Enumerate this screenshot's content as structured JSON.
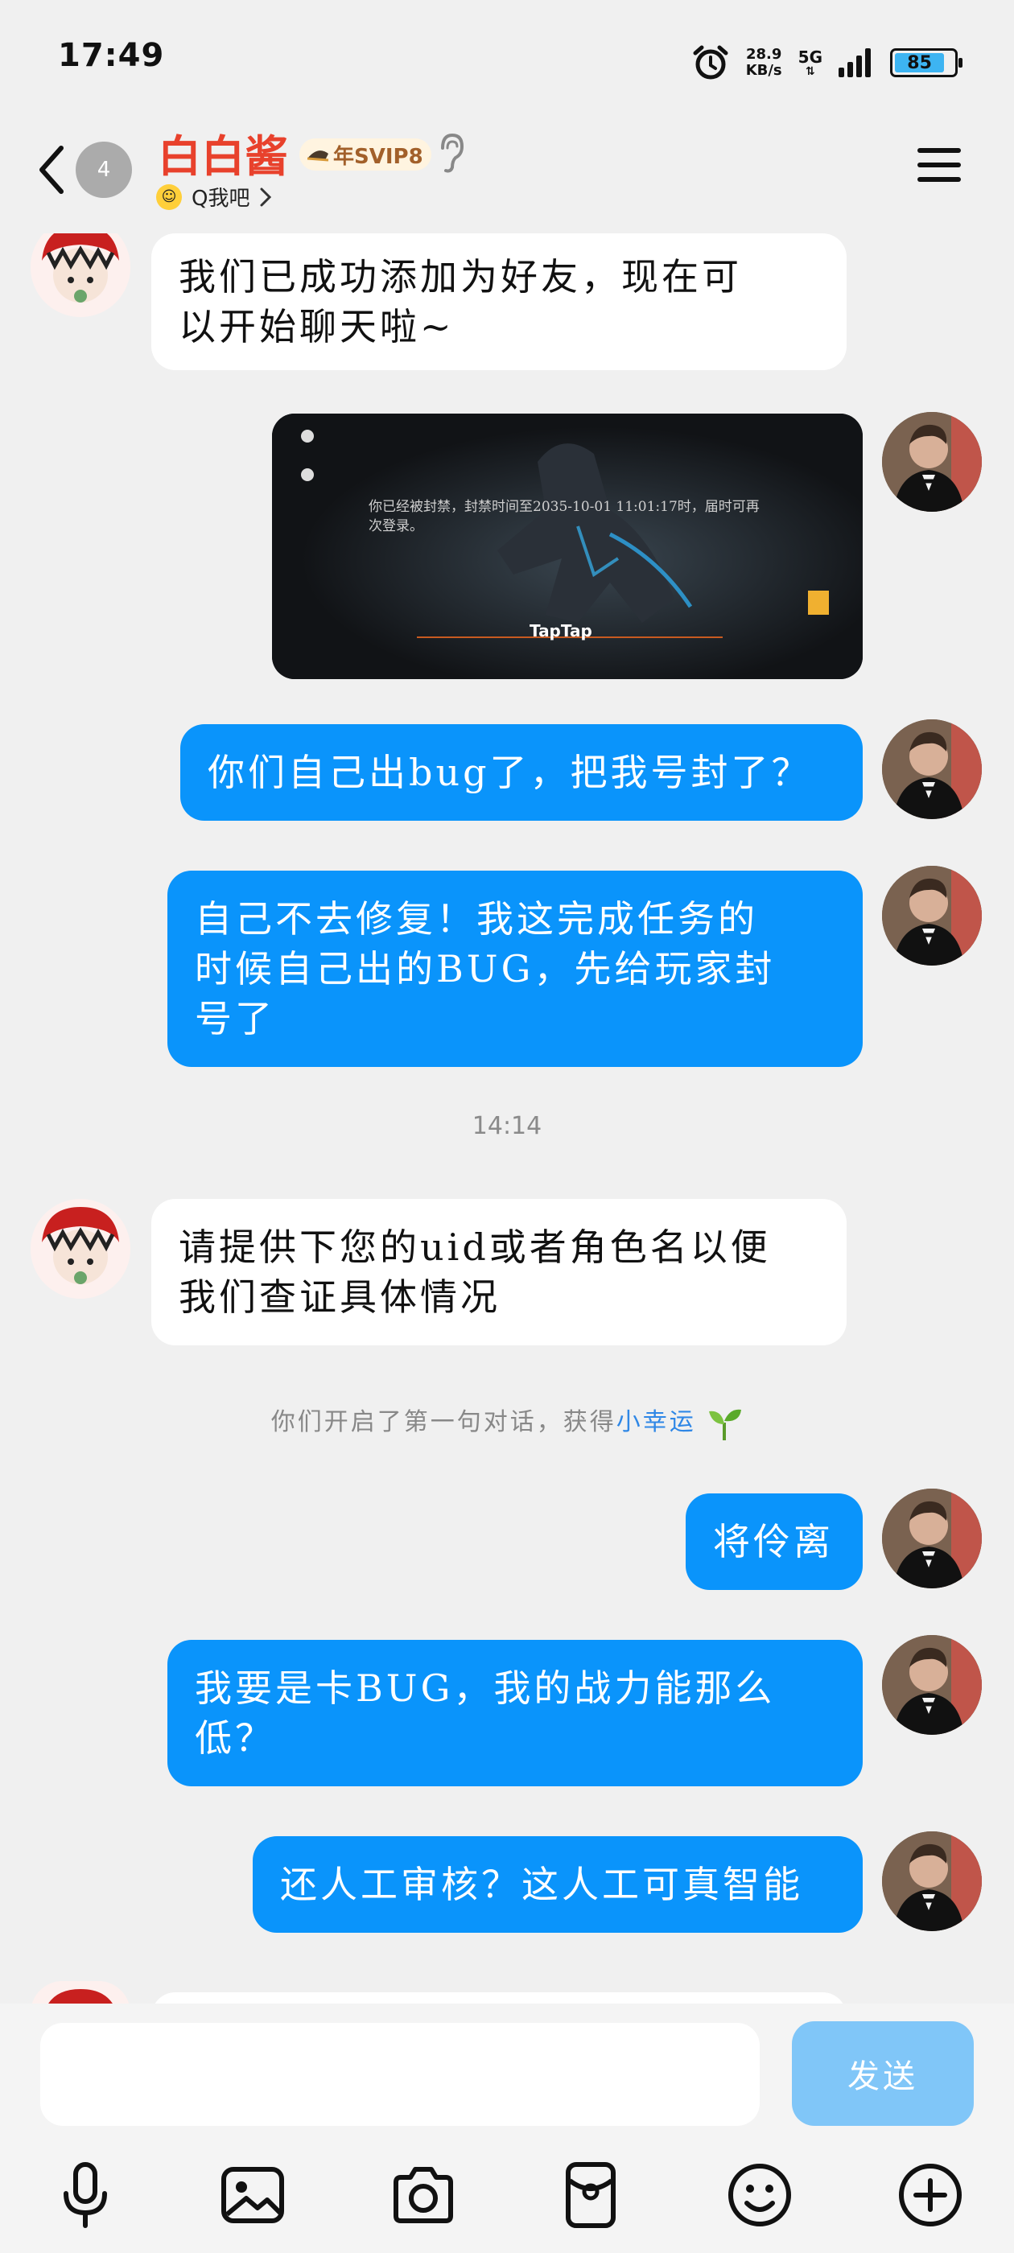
{
  "status_bar": {
    "time": "17:49",
    "speed_value": "28.9",
    "speed_unit": "KB/s",
    "network": "5G",
    "battery": "85",
    "battery_level_percent": 85,
    "icons": [
      "alarm-icon",
      "signal-icon",
      "battery-icon"
    ]
  },
  "header": {
    "unread_count": "4",
    "contact_name": "白白酱",
    "vip_badge": "年SVIP8",
    "status_text": "Q我吧",
    "icons": [
      "back-icon",
      "ear-icon",
      "menu-icon",
      "smile-icon",
      "chevron-right-icon"
    ]
  },
  "messages": [
    {
      "side": "in",
      "text_lines": [
        "我们已成功添加为好友，现在可",
        "以开始聊天啦~"
      ]
    },
    {
      "side": "out",
      "type": "image",
      "image_text": "你已经被封禁，封禁时间至2035-10-01 11:01:17时，届时可再次登录。",
      "image_logo": "TapTap"
    },
    {
      "side": "out",
      "text_lines": [
        "你们自己出bug了，把我号封了？"
      ]
    },
    {
      "side": "out",
      "text_lines": [
        "自己不去修复！我这完成任务的",
        "时候自己出的BUG，先给玩家封",
        "号了"
      ]
    },
    {
      "type": "timestamp",
      "text": "14:14"
    },
    {
      "side": "in",
      "text_lines": [
        "请提供下您的uid或者角色名以便",
        "我们查证具体情况"
      ]
    },
    {
      "type": "notice",
      "text": "你们开启了第一句对话，获得",
      "highlight": "小幸运"
    },
    {
      "side": "out",
      "text_lines": [
        "将伶离"
      ]
    },
    {
      "side": "out",
      "text_lines": [
        "我要是卡BUG，我的战力能那么",
        "低？"
      ]
    },
    {
      "side": "out",
      "text_lines": [
        "还人工审核？这人工可真智能"
      ]
    }
  ],
  "input": {
    "placeholder": "",
    "send_label": "发送"
  },
  "toolbar": {
    "icons": [
      "microphone-icon",
      "image-icon",
      "camera-icon",
      "red-packet-icon",
      "emoji-icon",
      "plus-icon"
    ]
  },
  "colors": {
    "outgoing_bubble": "#0a94fb",
    "incoming_bubble": "#ffffff",
    "name": "#e8412c",
    "send_button": "#80c6f8",
    "background": "#f0f0f0"
  }
}
